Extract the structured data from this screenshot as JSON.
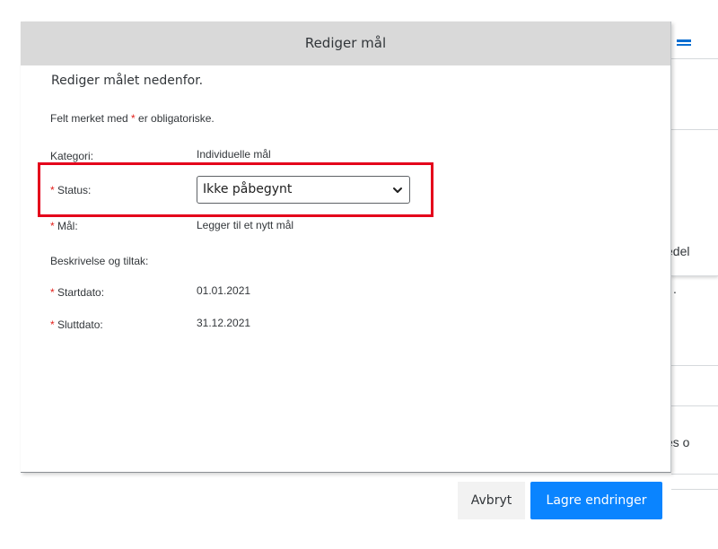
{
  "dialog": {
    "title": "Rediger mål",
    "intro": "Rediger målet nedenfor.",
    "required_hint_before": "Felt merket med ",
    "required_marker": "*",
    "required_hint_after": " er obligatoriske."
  },
  "form": {
    "category_label": "Kategori:",
    "category_value": "Individuelle mål",
    "status_label": "Status:",
    "status_value": "Ikke påbegynt",
    "goal_label": "Mål:",
    "goal_value": "Legger til et nytt mål",
    "description_label": "Beskrivelse og tiltak:",
    "start_label": "Startdato:",
    "start_value": "01.01.2021",
    "end_label": "Sluttdato:",
    "end_value": "31.12.2021"
  },
  "footer": {
    "cancel_label": "Avbryt",
    "save_label": "Lagre endringer"
  },
  "background": {
    "text_1": "edel",
    "text_2": ".",
    "text_3": "es o"
  },
  "colors": {
    "header_bg": "#d9d9d9",
    "required": "#e3201b",
    "highlight": "#e4001b",
    "primary_button": "#0a84ff"
  }
}
